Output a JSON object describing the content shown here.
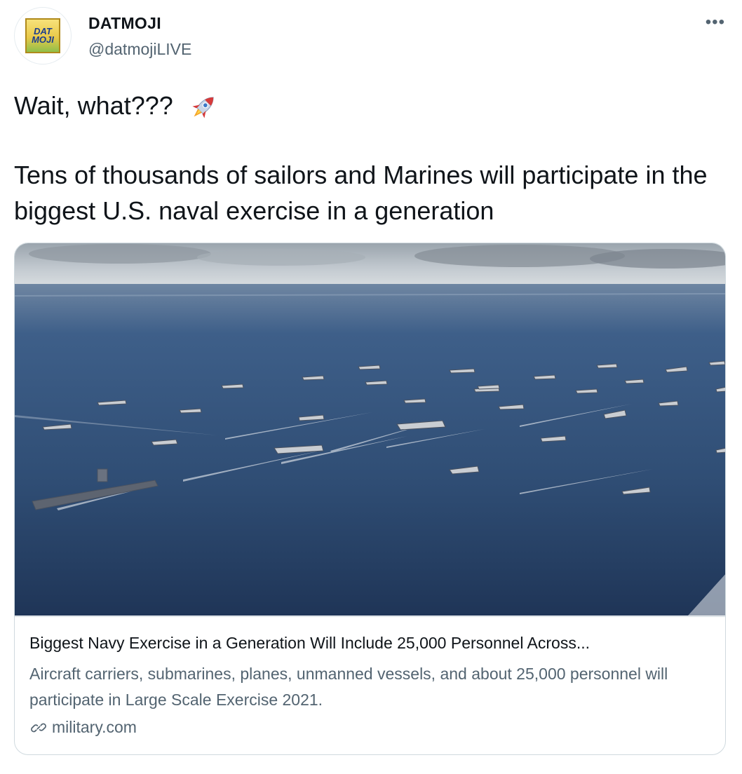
{
  "author": {
    "name": "DATMOJI",
    "handle": "@datmojiLIVE",
    "avatar_text_top": "DAT",
    "avatar_text_bottom": "MOJI"
  },
  "more_label": "•••",
  "tweet": {
    "line1": "Wait, what???",
    "line1_emoji": "rocket-icon",
    "line2": "Tens of thousands of sailors and Marines will participate in the biggest U.S. naval exercise in a generation"
  },
  "card": {
    "title": "Biggest Navy Exercise in a Generation Will Include 25,000 Personnel Across...",
    "description": "Aircraft carriers, submarines, planes, unmanned vessels, and about 25,000 personnel will participate in Large Scale Exercise 2021.",
    "domain": "military.com",
    "domain_icon": "link-icon",
    "image_subject": "fleet-of-naval-ships-photo"
  },
  "colors": {
    "text": "#0f1419",
    "secondary": "#536471",
    "border": "#cfd9de",
    "sea": "#2f4d74"
  }
}
